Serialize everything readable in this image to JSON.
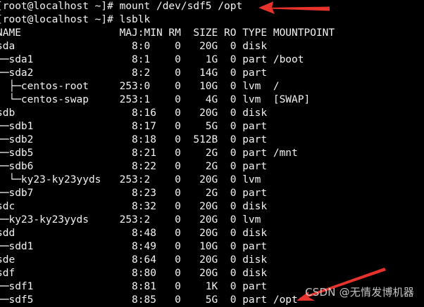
{
  "terminal": {
    "colors": {
      "background": "#000000",
      "text": "#f2f2f2",
      "annotation_arrow": "#e8322c"
    },
    "lines": [
      "[root@localhost ~]# mount /dev/sdf5 /opt",
      "[root@localhost ~]# lsblk",
      "NAME                MAJ:MIN RM  SIZE RO TYPE MOUNTPOINT",
      "sda                   8:0    0   20G  0 disk",
      "├─sda1                8:1    0    1G  0 part /boot",
      "└─sda2                8:2    0   14G  0 part",
      "  ├─centos-root     253:0    0   10G  0 lvm  /",
      "  └─centos-swap     253:1    0    4G  0 lvm  [SWAP]",
      "sdb                   8:16   0   20G  0 disk",
      "├─sdb1                8:17   0    5G  0 part",
      "├─sdb2                8:18   0  512B  0 part",
      "├─sdb5                8:21   0    2G  0 part /mnt",
      "├─sdb6                8:22   0    2G  0 part",
      "│ └─ky23-ky23yyds   253:2    0   20G  0 lvm",
      "└─sdb7                8:23   0    2G  0 part",
      "sdc                   8:32   0   20G  0 disk",
      "└─ky23-ky23yyds     253:2    0   20G  0 lvm",
      "sdd                   8:48   0   20G  0 disk",
      "└─sdd1                8:49   0   10G  0 part",
      "sde                   8:64   0   20G  0 disk",
      "sdf                   8:80   0   20G  0 disk",
      "├─sdf1                8:81   0    1K  0 part",
      "└─sdf5                8:85   0    5G  0 part /opt"
    ]
  },
  "watermark": {
    "text": "CSDN @无情发博机器"
  }
}
